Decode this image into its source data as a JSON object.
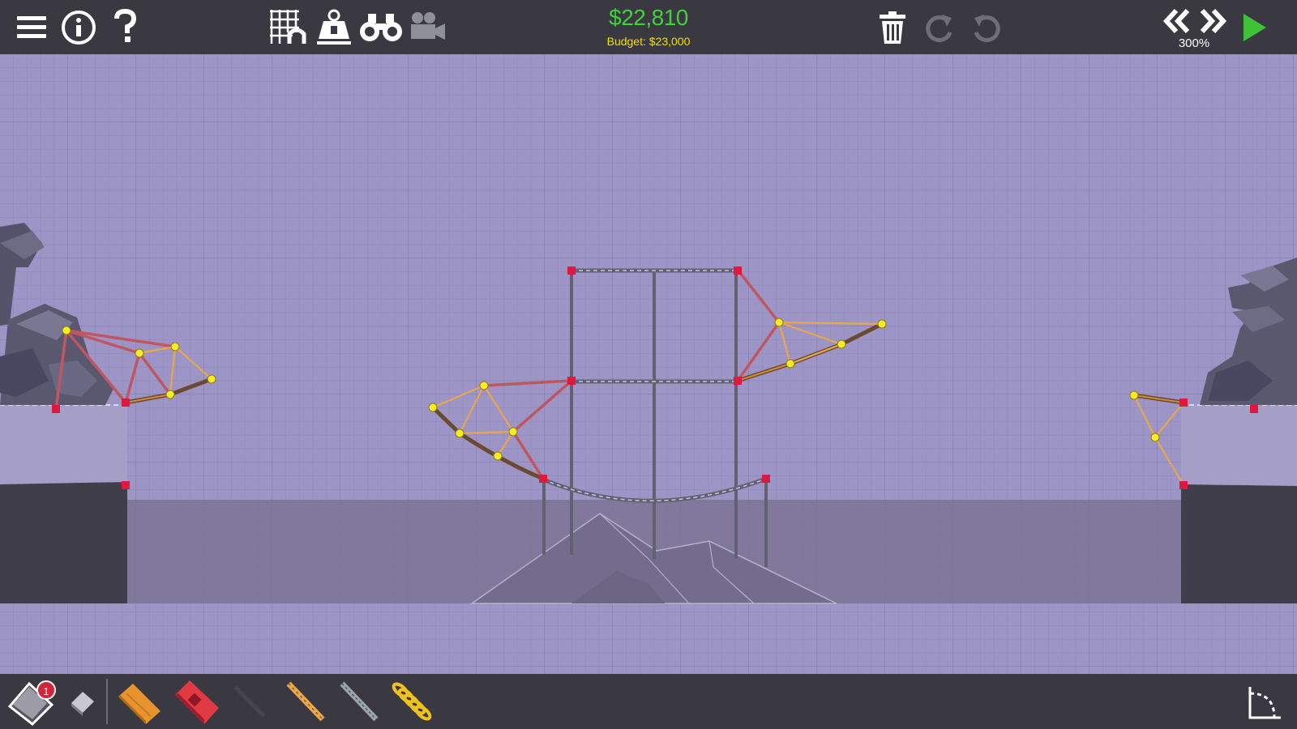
{
  "toolbar": {
    "menu_icon": "hamburger-menu-icon",
    "info_icon": "info-circle-icon",
    "help_icon": "question-mark-icon",
    "grid_icon": "grid-snap-icon",
    "weight_icon": "weight-load-icon",
    "binoculars_icon": "binoculars-icon",
    "camera_icon": "camera-icon",
    "trash_icon": "trash-icon",
    "redo_icon": "redo-icon",
    "undo_icon": "undo-icon",
    "rewind_icon": "rewind-icon",
    "fast_forward_icon": "fast-forward-icon",
    "play_icon": "play-icon"
  },
  "cost": {
    "spent": "$22,810",
    "budget": "Budget: $23,000"
  },
  "simulation": {
    "speed": "300%"
  },
  "materials": {
    "badge_count": "1",
    "items": [
      {
        "name": "road-material",
        "icon": "road-plank-icon"
      },
      {
        "name": "eraser",
        "icon": "eraser-icon"
      },
      {
        "name": "wood-material",
        "icon": "wood-beam-icon"
      },
      {
        "name": "reinforced-road-material",
        "icon": "reinforced-road-icon"
      },
      {
        "name": "steel-material",
        "icon": "steel-beam-icon"
      },
      {
        "name": "rope-material",
        "icon": "rope-icon"
      },
      {
        "name": "cable-material",
        "icon": "cable-icon"
      },
      {
        "name": "spring-material",
        "icon": "spring-icon"
      }
    ]
  },
  "colors": {
    "background": "#9c95c6",
    "toolbar": "#3a3942",
    "cost": "#3fd33a",
    "budget": "#f1e000",
    "play": "#3fc23a",
    "anchor": "#e0173e",
    "joint": "#f6ec2a",
    "wood": "#e8a64d",
    "road": "#6a4a33",
    "steel": "#c05662",
    "hydraulic": "#616172"
  }
}
